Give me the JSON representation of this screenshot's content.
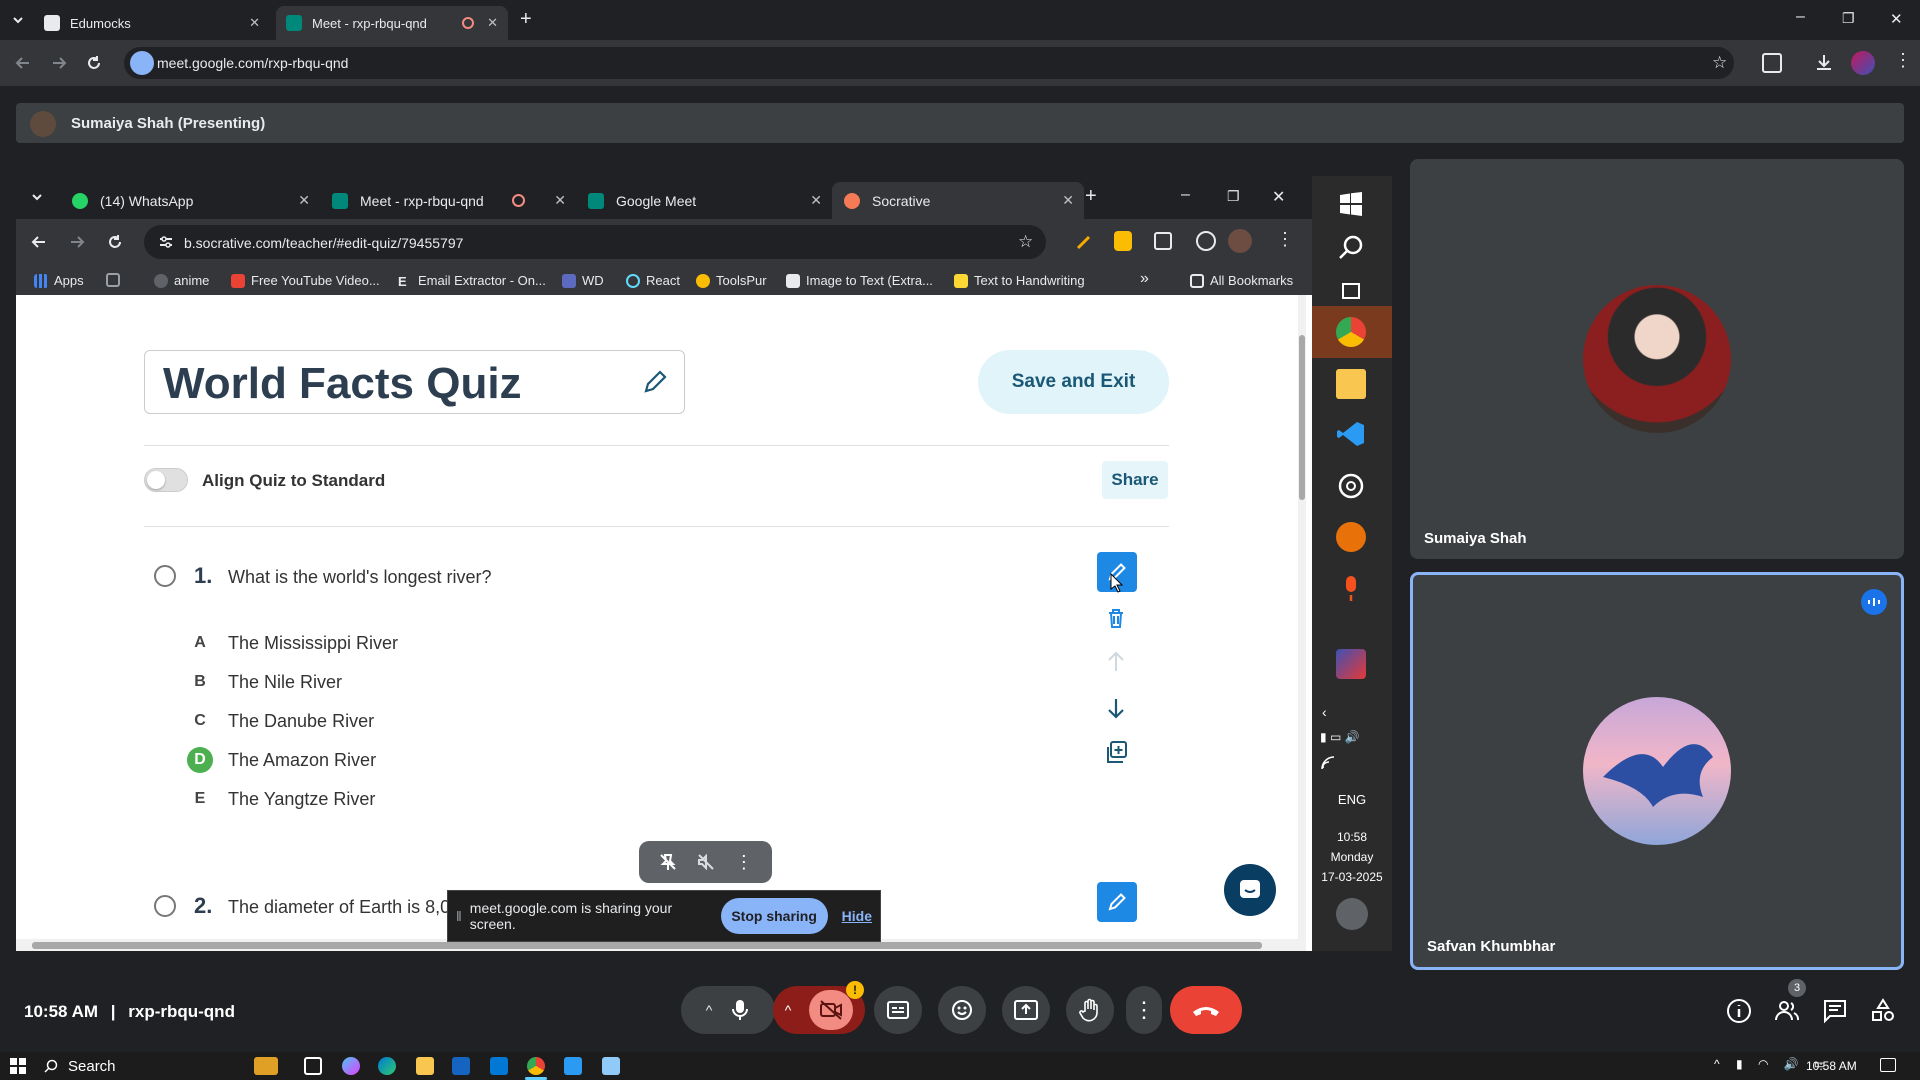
{
  "outer_browser": {
    "tabs": [
      {
        "title": "Edumocks",
        "close": "✕"
      },
      {
        "title": "Meet - rxp-rbqu-qnd",
        "close": "✕"
      }
    ],
    "new_tab": "+",
    "url": "meet.google.com/rxp-rbqu-qnd",
    "window_controls": [
      "–",
      "❐",
      "✕"
    ]
  },
  "presenter": {
    "name": "Sumaiya Shah (Presenting)"
  },
  "inner_browser": {
    "tabs": [
      {
        "title": "(14) WhatsApp",
        "color": "#25d366"
      },
      {
        "title": "Meet - rxp-rbqu-qnd",
        "color": "#00897b"
      },
      {
        "title": "Google Meet",
        "color": "#00897b"
      },
      {
        "title": "Socrative",
        "color": "#f47b55"
      }
    ],
    "close": "✕",
    "new_tab": "+",
    "url": "b.socrative.com/teacher/#edit-quiz/79455797",
    "bookmarks": [
      {
        "label": "Apps",
        "color": "#4285f4"
      },
      {
        "label": "",
        "color": "#9aa0a6"
      },
      {
        "label": "anime",
        "color": "#202124"
      },
      {
        "label": "Free YouTube Video...",
        "color": "#ea4335"
      },
      {
        "label": "Email Extractor - On...",
        "color": "#ffffff"
      },
      {
        "label": "WD",
        "color": "#5c6bc0"
      },
      {
        "label": "React",
        "color": "#61dafb"
      },
      {
        "label": "ToolsPur",
        "color": "#fbbc04"
      },
      {
        "label": "Image to Text (Extra...",
        "color": "#e8eaed"
      },
      {
        "label": "Text to Handwriting",
        "color": "#fdd835"
      }
    ],
    "more_bookmarks": "»",
    "all_bookmarks": "All Bookmarks"
  },
  "quiz": {
    "title": "World Facts Quiz",
    "save_label": "Save and Exit",
    "align_label": "Align Quiz to Standard",
    "share_label": "Share",
    "questions": [
      {
        "number": "1.",
        "text": "What is the world's longest river?",
        "options": [
          {
            "letter": "A",
            "text": "The Mississippi River",
            "correct": false
          },
          {
            "letter": "B",
            "text": "The Nile River",
            "correct": false
          },
          {
            "letter": "C",
            "text": "The Danube River",
            "correct": false
          },
          {
            "letter": "D",
            "text": "The Amazon River",
            "correct": true
          },
          {
            "letter": "E",
            "text": "The Yangtze River",
            "correct": false
          }
        ]
      },
      {
        "number": "2.",
        "text": "The diameter of Earth is 8,0"
      }
    ]
  },
  "share_notice": {
    "text": "meet.google.com is sharing your screen.",
    "stop": "Stop sharing",
    "hide": "Hide"
  },
  "inner_taskbar": {
    "lang": "ENG",
    "time": "10:58",
    "day": "Monday",
    "date": "17-03-2025"
  },
  "participants": [
    {
      "name": "Sumaiya Shah"
    },
    {
      "name": "Safvan Khumbhar"
    }
  ],
  "meet_bar": {
    "time": "10:58 AM",
    "separator": "|",
    "code": "rxp-rbqu-qnd",
    "people_count": "3",
    "cam_alert": "!"
  },
  "taskbar": {
    "search": "Search",
    "time": "10:58 AM"
  },
  "colors": {
    "accent_blue": "#1e88e5",
    "correct_green": "#4caf50",
    "end_call_red": "#ea4335",
    "active_tile_border": "#8ab4f8"
  }
}
